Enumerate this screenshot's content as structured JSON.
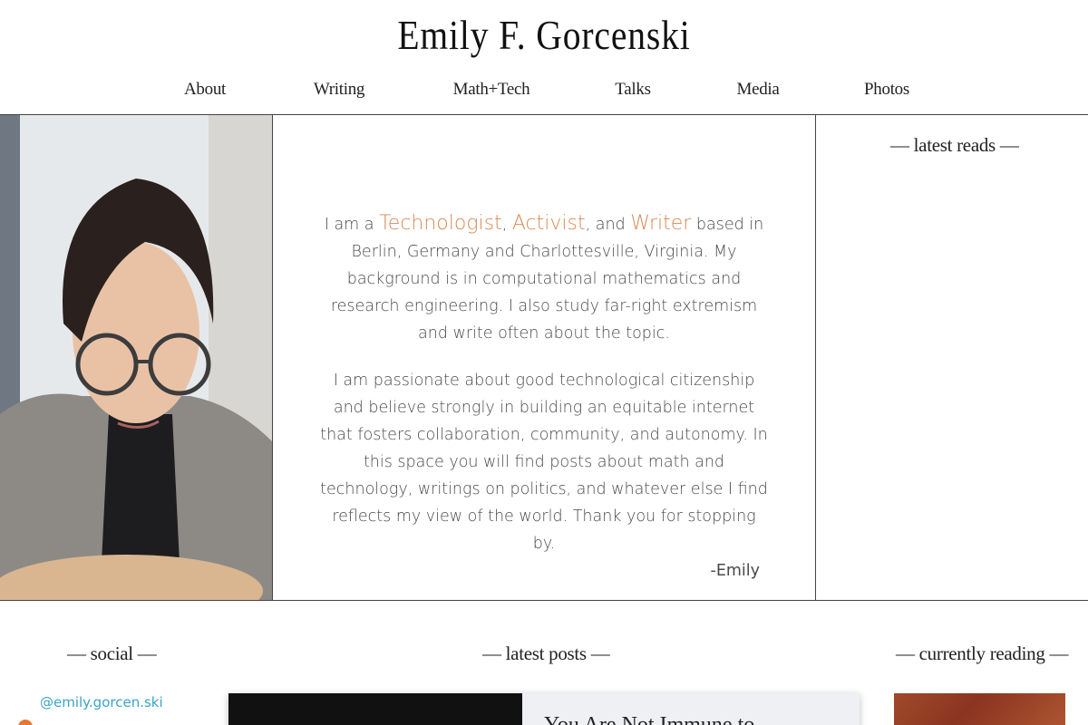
{
  "site": {
    "title": "Emily F. Gorcenski"
  },
  "nav": [
    {
      "label": "About"
    },
    {
      "label": "Writing"
    },
    {
      "label": "Math+Tech"
    },
    {
      "label": "Talks"
    },
    {
      "label": "Media"
    },
    {
      "label": "Photos"
    }
  ],
  "latest_reads": {
    "heading": "— latest reads —"
  },
  "bio": {
    "intro_prefix": "I am a ",
    "role1": "Technologist",
    "sep1": ", ",
    "role2": "Activist",
    "sep2": ", and ",
    "role3": "Writer",
    "intro_rest": " based in Berlin, Germany and Charlottesville, Virginia. My background is in computational mathematics and research engineering. I also study far-right extremism and write often about the topic.",
    "paragraph2": "I am passionate about good technological citizenship and believe strongly in building an equitable internet that fosters collaboration, community, and autonomy. In this space you will find posts about math and technology, writings on politics, and whatever else I find reflects my view of the world. Thank you for stopping by.",
    "signature": "-Emily",
    "accent_color": "#d98a55"
  },
  "social": {
    "heading": "— social —",
    "handle": "@emily.gorcen.ski",
    "handle_color": "#3aa3c9"
  },
  "latest_posts": {
    "heading": "— latest posts —",
    "first_post_title": "You Are Not Immune to"
  },
  "currently_reading": {
    "heading": "— currently reading —"
  },
  "icons": {
    "rss": "rss-icon"
  }
}
